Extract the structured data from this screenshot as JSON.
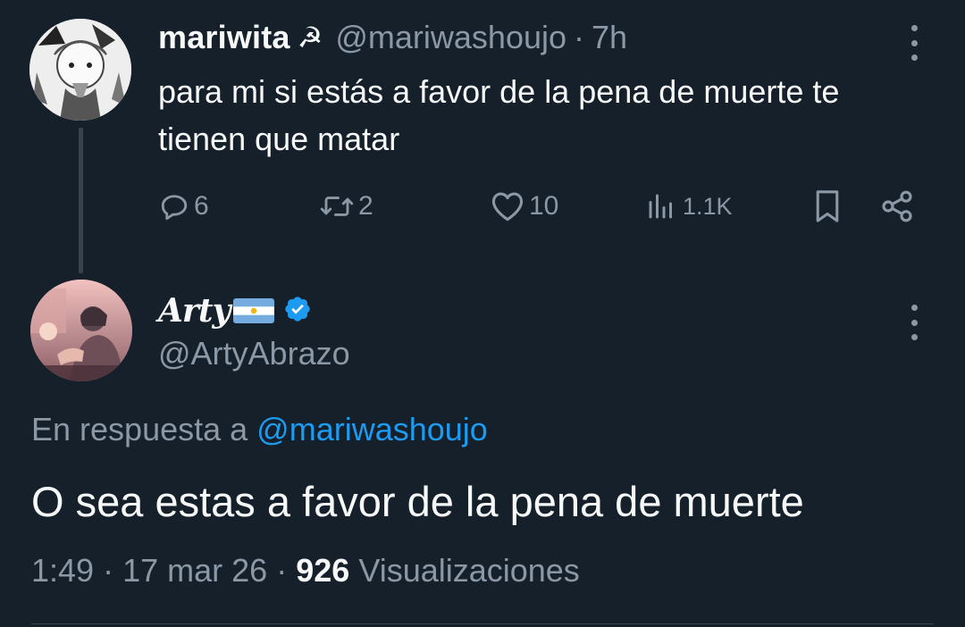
{
  "parent": {
    "display_name": "mariwita",
    "name_emoji": "☭",
    "handle": "@mariwashoujo",
    "separator": "·",
    "time": "7h",
    "text": "para mi si estás a favor de la pena de muerte te tienen que matar",
    "actions": {
      "reply_count": "6",
      "retweet_count": "2",
      "like_count": "10",
      "views_count": "1.1K"
    },
    "icons": [
      "reply-icon",
      "retweet-icon",
      "like-icon",
      "views-icon",
      "bookmark-icon",
      "share-icon",
      "more-icon"
    ]
  },
  "reply": {
    "display_name": "Arty",
    "flag": "argentina-flag",
    "verified": true,
    "handle": "@ArtyAbrazo",
    "in_reply_prefix": "En respuesta a",
    "in_reply_mention": "@mariwashoujo",
    "text": "O sea estas a favor de la pena de muerte",
    "time": "1:49",
    "date": "17 mar 26",
    "separator": "·",
    "views_number": "926",
    "views_label": "Visualizaciones"
  },
  "colors": {
    "background": "#15202b",
    "text_primary": "#f7f9f9",
    "text_secondary": "#8b98a5",
    "accent": "#1d9bf0",
    "divider": "#38444d"
  }
}
